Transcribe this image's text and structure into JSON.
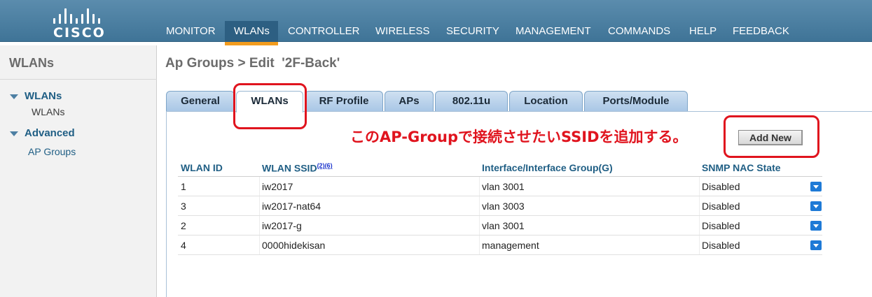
{
  "header": {
    "logo_text": "CISCO",
    "menu": [
      {
        "label": "MONITOR"
      },
      {
        "label": "WLANs"
      },
      {
        "label": "CONTROLLER"
      },
      {
        "label": "WIRELESS"
      },
      {
        "label": "SECURITY"
      },
      {
        "label": "MANAGEMENT"
      },
      {
        "label": "COMMANDS"
      },
      {
        "label": "HELP"
      },
      {
        "label": "FEEDBACK"
      }
    ],
    "active_menu": "WLANs",
    "accent_color": "#f39c1e"
  },
  "sidebar": {
    "title": "WLANs",
    "groups": [
      {
        "label": "WLANs",
        "items": [
          "WLANs"
        ]
      },
      {
        "label": "Advanced",
        "items": [
          "AP Groups"
        ]
      }
    ]
  },
  "main": {
    "title": "Ap Groups > Edit  '2F-Back'",
    "tabs": [
      "General",
      "WLANs",
      "RF Profile",
      "APs",
      "802.11u",
      "Location",
      "Ports/Module"
    ],
    "active_tab": "WLANs",
    "annotation": "このAP-Groupで接続させたいSSIDを追加する。",
    "add_button": "Add New",
    "table": {
      "headers": [
        "WLAN ID",
        "WLAN SSID",
        "Interface/Interface Group(G)",
        "SNMP NAC State"
      ],
      "ssid_footnotes": [
        "(2)",
        "(6)"
      ],
      "rows": [
        {
          "id": "1",
          "ssid": "iw2017",
          "interface": "vlan 3001",
          "nac": "Disabled"
        },
        {
          "id": "3",
          "ssid": "iw2017-nat64",
          "interface": "vlan 3003",
          "nac": "Disabled"
        },
        {
          "id": "2",
          "ssid": "iw2017-g",
          "interface": "vlan 3001",
          "nac": "Disabled"
        },
        {
          "id": "4",
          "ssid": "0000hidekisan",
          "interface": "management",
          "nac": "Disabled"
        }
      ]
    }
  }
}
